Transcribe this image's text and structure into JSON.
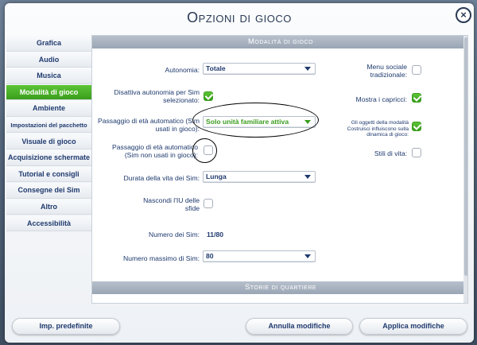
{
  "title": "Opzioni di gioco",
  "close_label": "×",
  "sidebar": {
    "items": [
      {
        "label": "Grafica"
      },
      {
        "label": "Audio"
      },
      {
        "label": "Musica"
      },
      {
        "label": "Modalità di gioco",
        "active": true
      },
      {
        "label": "Ambiente"
      },
      {
        "label": "Impostazioni del pacchetto"
      },
      {
        "label": "Visuale di gioco"
      },
      {
        "label": "Acquisizione schermate"
      },
      {
        "label": "Tutorial e consigli"
      },
      {
        "label": "Consegne dei Sim"
      },
      {
        "label": "Altro"
      },
      {
        "label": "Accessibilità"
      }
    ]
  },
  "main": {
    "section_title": "Modalità di gioco",
    "section2_title": "Storie di quartiere",
    "autonomy": {
      "label": "Autonomia:",
      "value": "Totale"
    },
    "disable_autonomy": {
      "label": "Disattiva autonomia per Sim selezionato:",
      "checked": true
    },
    "aging_played": {
      "label": "Passaggio di età automatico (Sim usati in gioco):",
      "value": "Solo unità familiare attiva"
    },
    "aging_unplayed": {
      "label": "Passaggio di età automatico (Sim non usati in gioco):",
      "checked": false
    },
    "lifespan": {
      "label": "Durata della vita dei Sim:",
      "value": "Lunga"
    },
    "hide_challenges": {
      "label": "Nascondi l'IU delle sfide",
      "checked": false
    },
    "sim_count": {
      "label": "Numero dei Sim:",
      "value": "11/80"
    },
    "max_sims": {
      "label": "Numero massimo di Sim:",
      "value": "80"
    },
    "social_menu": {
      "label": "Menu sociale tradizionale:",
      "checked": false
    },
    "show_whims": {
      "label": "Mostra i capricci:",
      "checked": true
    },
    "build_mode_objects": {
      "label": "Gli oggetti della modalità Costruisci influiscono sulla dinamica di gioco:",
      "checked": true
    },
    "lifestyles": {
      "label": "Stili di vita:",
      "checked": false
    }
  },
  "buttons": {
    "defaults": "Imp. predefinite",
    "cancel": "Annulla modifiche",
    "apply": "Applica modifiche"
  },
  "colors": {
    "accent_green": "#3a9d1d",
    "text_blue": "#1f3a6e"
  }
}
